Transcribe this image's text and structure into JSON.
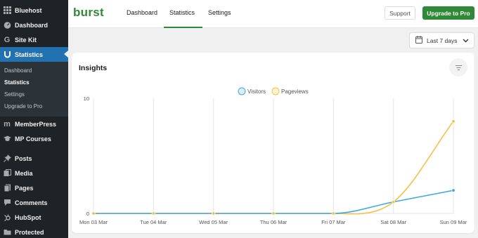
{
  "sidebar": {
    "items": [
      {
        "label": "Bluehost",
        "icon": "grid-icon"
      },
      {
        "label": "Dashboard",
        "icon": "dashboard-gauge-icon"
      },
      {
        "label": "Site Kit",
        "icon": "google-g-icon"
      },
      {
        "label": "Statistics",
        "icon": "burst-u-icon"
      },
      {
        "label": "MemberPress",
        "icon": "memberpress-m-icon"
      },
      {
        "label": "MP Courses",
        "icon": "graduation-cap-icon"
      },
      {
        "label": "Posts",
        "icon": "pin-icon"
      },
      {
        "label": "Media",
        "icon": "media-icon"
      },
      {
        "label": "Pages",
        "icon": "pages-icon"
      },
      {
        "label": "Comments",
        "icon": "comment-bubble-icon"
      },
      {
        "label": "HubSpot",
        "icon": "hubspot-sprocket-icon"
      },
      {
        "label": "Protected",
        "icon": "folder-icon"
      }
    ],
    "submenu": [
      "Dashboard",
      "Statistics",
      "Settings",
      "Upgrade to Pro"
    ]
  },
  "header": {
    "logo": "burst",
    "tabs": [
      "Dashboard",
      "Statistics",
      "Settings"
    ],
    "support_label": "Support",
    "upgrade_label": "Upgrade to Pro"
  },
  "date_range": {
    "label": "Last 7 days"
  },
  "insights": {
    "title": "Insights"
  },
  "colors": {
    "brand": "#2e8a37",
    "wp_active": "#2271b1",
    "visitors": "#3da9e0",
    "pageviews": "#f2c247"
  },
  "chart_data": {
    "type": "line",
    "categories": [
      "Mon 03 Mar",
      "Tue 04 Mar",
      "Wed 05 Mar",
      "Thu 06 Mar",
      "Fri 07 Mar",
      "Sat 08 Mar",
      "Sun 09 Mar"
    ],
    "series": [
      {
        "name": "Visitors",
        "values": [
          0,
          0,
          0,
          0,
          0,
          1,
          2
        ]
      },
      {
        "name": "Pageviews",
        "values": [
          0,
          0,
          0,
          0,
          0,
          1,
          8
        ]
      }
    ],
    "yticks": [
      "0",
      "10"
    ],
    "ylim": [
      0,
      10
    ],
    "grid": true,
    "legend": "top-center"
  }
}
